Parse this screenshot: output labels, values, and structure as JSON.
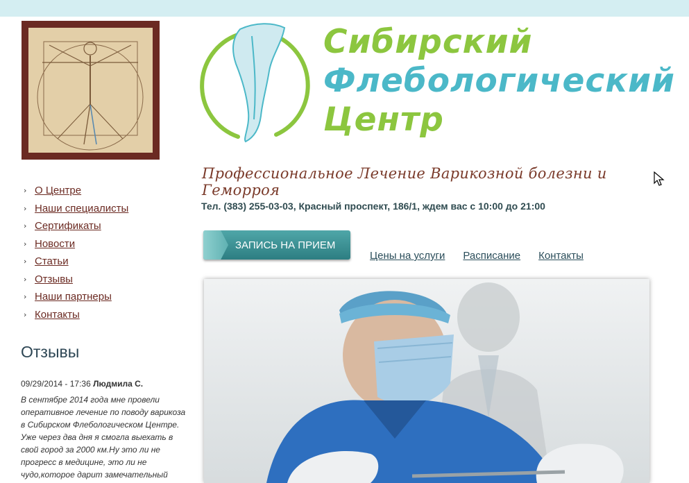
{
  "brand": {
    "line1": "Сибирский",
    "line2": "Флебологический",
    "line3": "Центр",
    "tagline": "Профессиональное Лечение Варикозной болезни и Геморроя",
    "green": "#8cc63f",
    "blue": "#4bb8c8"
  },
  "contact": "Тел. (383) 255-03-03, Красный проспект, 186/1, ждем вас с 10:00 до 21:00",
  "nav": [
    {
      "label": "О Центре"
    },
    {
      "label": "Наши специалисты"
    },
    {
      "label": "Сертификаты"
    },
    {
      "label": "Новости"
    },
    {
      "label": "Статьи"
    },
    {
      "label": "Отзывы"
    },
    {
      "label": "Наши партнеры"
    },
    {
      "label": "Контакты"
    }
  ],
  "booking_button": "ЗАПИСЬ НА ПРИЕМ",
  "links": [
    {
      "label": "Цены на услуги"
    },
    {
      "label": "Расписание"
    },
    {
      "label": "Контакты"
    }
  ],
  "reviews": {
    "title": "Отзывы",
    "date": "09/29/2014 - 17:36",
    "author": "Людмила С.",
    "text": "В сентябре 2014 года мне провели оперативное лечение по поводу варикоза в Сибирском Флебологическом Центре. Уже через два дня я смогла выехать в свой город за 2000 км.Ну это ли не прогресс в медицине, это ли не чудо,которое дарит замечательный"
  },
  "icons": {
    "nav_bullet": "chevron-right-icon",
    "logo": "leg-in-circle-logo",
    "cursor": "mouse-pointer-icon"
  }
}
